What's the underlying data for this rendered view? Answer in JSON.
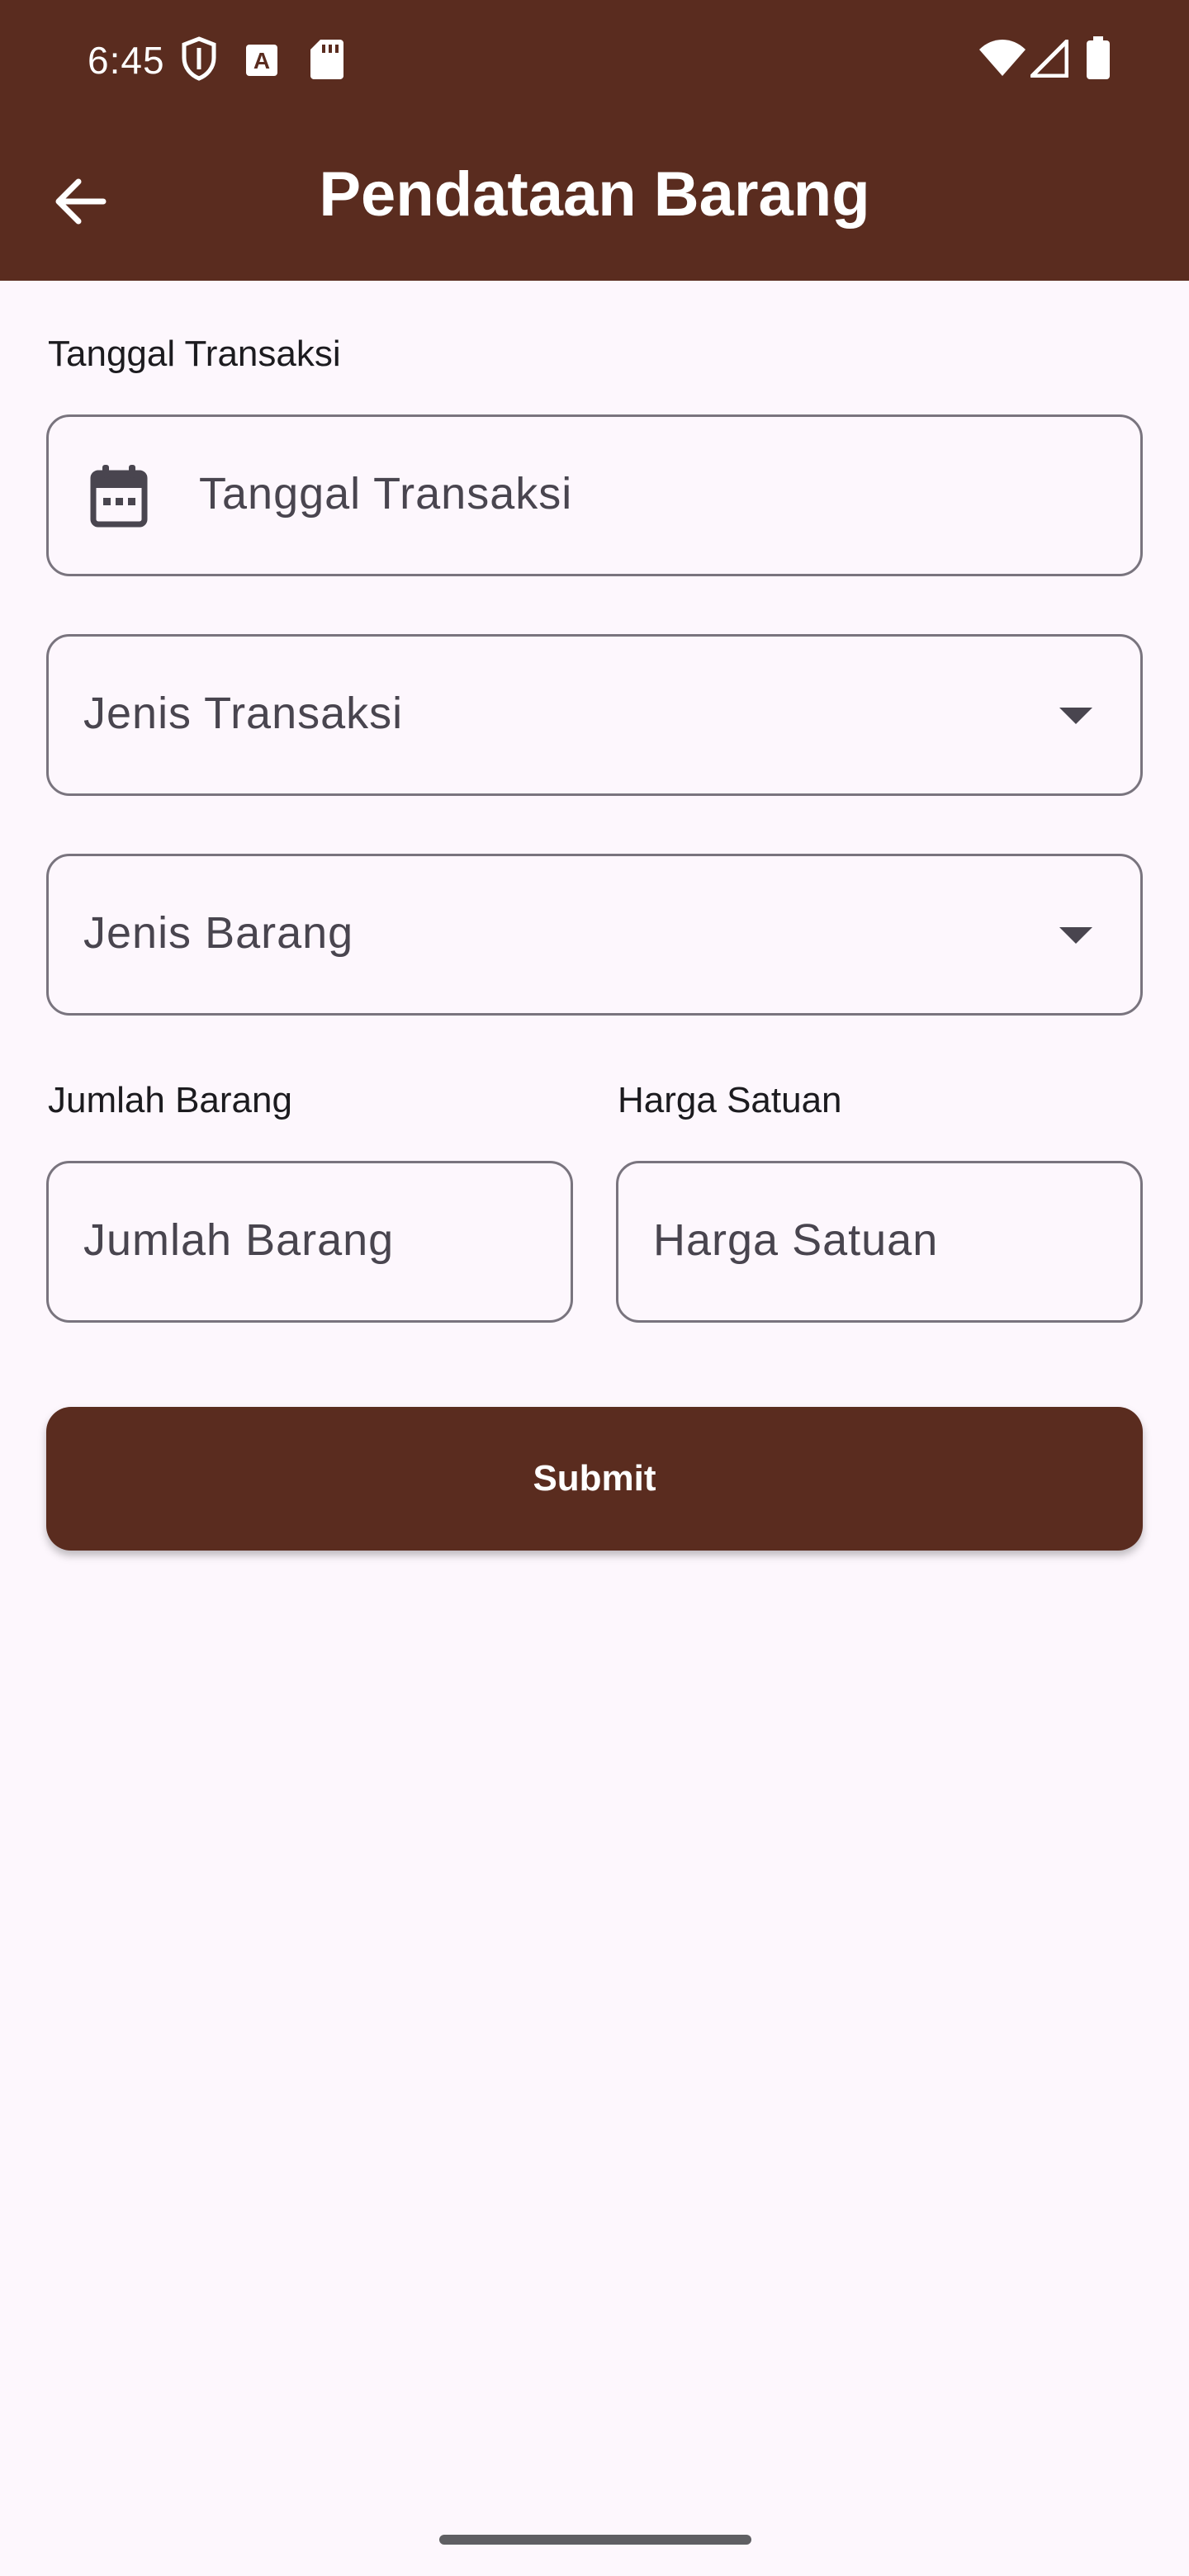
{
  "status_bar": {
    "time": "6:45",
    "icons": [
      "shield-icon",
      "font-download-icon",
      "sd-card-icon",
      "wifi-icon",
      "signal-icon",
      "battery-icon"
    ]
  },
  "app_bar": {
    "title": "Pendataan Barang",
    "back_icon": "arrow-left-icon",
    "color": "#5a2c1f"
  },
  "form": {
    "tanggal": {
      "label": "Tanggal Transaksi",
      "placeholder": "Tanggal Transaksi",
      "icon": "calendar-icon"
    },
    "jenis_transaksi": {
      "placeholder": "Jenis Transaksi",
      "icon": "dropdown-arrow-icon"
    },
    "jenis_barang": {
      "placeholder": "Jenis Barang",
      "icon": "dropdown-arrow-icon"
    },
    "jumlah": {
      "label": "Jumlah Barang",
      "placeholder": "Jumlah Barang"
    },
    "harga": {
      "label": "Harga Satuan",
      "placeholder": "Harga Satuan"
    },
    "submit_label": "Submit"
  }
}
